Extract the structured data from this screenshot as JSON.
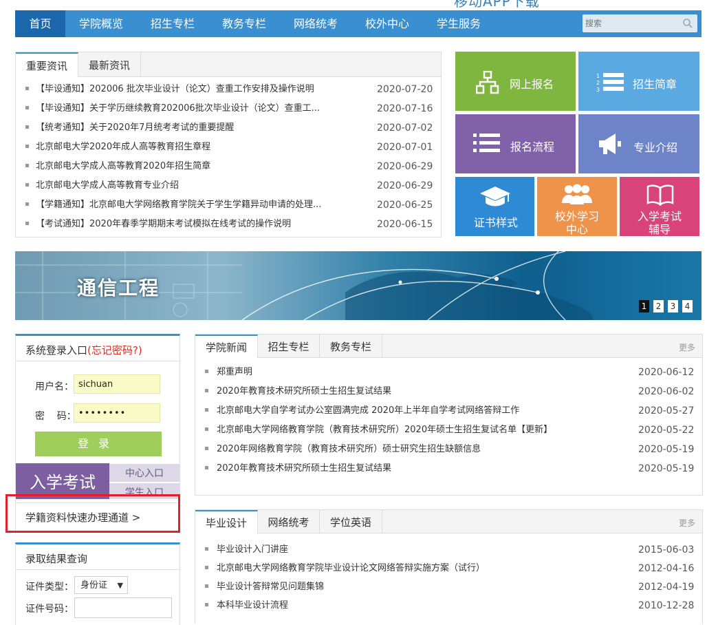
{
  "app_download": "移动APP下载",
  "nav": {
    "items": [
      "首页",
      "学院概览",
      "招生专栏",
      "教务专栏",
      "网络统考",
      "校外中心",
      "学生服务"
    ],
    "active_index": 0,
    "search_placeholder": "搜索"
  },
  "news": {
    "tabs": [
      "重要资讯",
      "最新资讯"
    ],
    "active_tab": 0,
    "items": [
      {
        "title": "【毕设通知】202006 批次毕业设计（论文）查重工作安排及操作说明",
        "date": "2020-07-20"
      },
      {
        "title": "【毕设通知】关于学历继续教育202006批次毕业设计（论文）查重工...",
        "date": "2020-07-16"
      },
      {
        "title": "【统考通知】关于2020年7月统考考试的重要提醒",
        "date": "2020-07-02"
      },
      {
        "title": "北京邮电大学2020年成人高等教育招生章程",
        "date": "2020-07-01"
      },
      {
        "title": "北京邮电大学成人高等教育2020年招生简章",
        "date": "2020-06-29"
      },
      {
        "title": "北京邮电大学成人高等教育专业介绍",
        "date": "2020-06-29"
      },
      {
        "title": "【学籍通知】北京邮电大学网络教育学院关于学生学籍异动申请的处理...",
        "date": "2020-06-25"
      },
      {
        "title": "【考试通知】2020年春季学期期末考试模拟在线考试的操作说明",
        "date": "2020-06-15"
      }
    ]
  },
  "tiles": [
    {
      "label": "网上报名",
      "icon": "sitemap-icon",
      "color": "#7fb63f"
    },
    {
      "label": "招生简章",
      "icon": "numbered-list-icon",
      "color": "#5aa9e0"
    },
    {
      "label": "报名流程",
      "icon": "list-icon",
      "color": "#8161a8"
    },
    {
      "label": "专业介绍",
      "icon": "megaphone-icon",
      "color": "#6e84c8"
    },
    {
      "label": "证书样式",
      "icon": "graduation-cap-icon",
      "color": "#2f8ad5"
    },
    {
      "label1": "校外学习",
      "label2": "中心",
      "icon": "group-icon",
      "color": "#f0934a"
    },
    {
      "label1": "入学考试",
      "label2": "辅导",
      "icon": "book-icon",
      "color": "#d8447a"
    }
  ],
  "banner": {
    "title": "通信工程",
    "pages": [
      "1",
      "2",
      "3",
      "4"
    ],
    "active_page": 0
  },
  "login": {
    "title": "系统登录入口",
    "forgot": "(忘记密码?)",
    "username_label": "用户名：",
    "username_value": "sichuan",
    "password_label": "密    码：",
    "password_value": "••••••••",
    "submit": "登录",
    "exam_banner": "入学考试",
    "exam_links": [
      "中心入口",
      "学生入口"
    ],
    "quick_link": "学籍资料快速办理通道 >"
  },
  "query": {
    "title": "录取结果查询",
    "id_type_label": "证件类型：",
    "id_type_value": "身份证",
    "id_number_label": "证件号码："
  },
  "college_news": {
    "tabs": [
      "学院新闻",
      "招生专栏",
      "教务专栏"
    ],
    "active_tab": 0,
    "more": "更多",
    "items": [
      {
        "title": "郑重声明",
        "date": "2020-06-12"
      },
      {
        "title": "2020年教育技术研究所硕士生招生复试结果",
        "date": "2020-06-02"
      },
      {
        "title": "北京邮电大学自学考试办公室圆满完成 2020年上半年自学考试网络答辩工作",
        "date": "2020-05-27"
      },
      {
        "title": "北京邮电大学网络教育学院（教育技术研究所）2020年硕士生招生复试名单【更新】",
        "date": "2020-05-22"
      },
      {
        "title": "2020年网络教育学院（教育技术研究所）硕士研究生招生缺额信息",
        "date": "2020-05-19"
      },
      {
        "title": "2020年教育技术研究所硕士生招生复试结果",
        "date": "2020-05-19"
      }
    ]
  },
  "graduation": {
    "tabs": [
      "毕业设计",
      "网络统考",
      "学位英语"
    ],
    "active_tab": 0,
    "more": "更多",
    "items": [
      {
        "title": "毕业设计入门讲座",
        "date": "2015-06-03"
      },
      {
        "title": "北京邮电大学网络教育学院毕业设计论文网络答辩实施方案（试行）",
        "date": "2012-04-16"
      },
      {
        "title": "毕业设计答辩常见问题集锦",
        "date": "2012-04-19"
      },
      {
        "title": "本科毕业设计流程",
        "date": "2010-12-28"
      }
    ]
  }
}
